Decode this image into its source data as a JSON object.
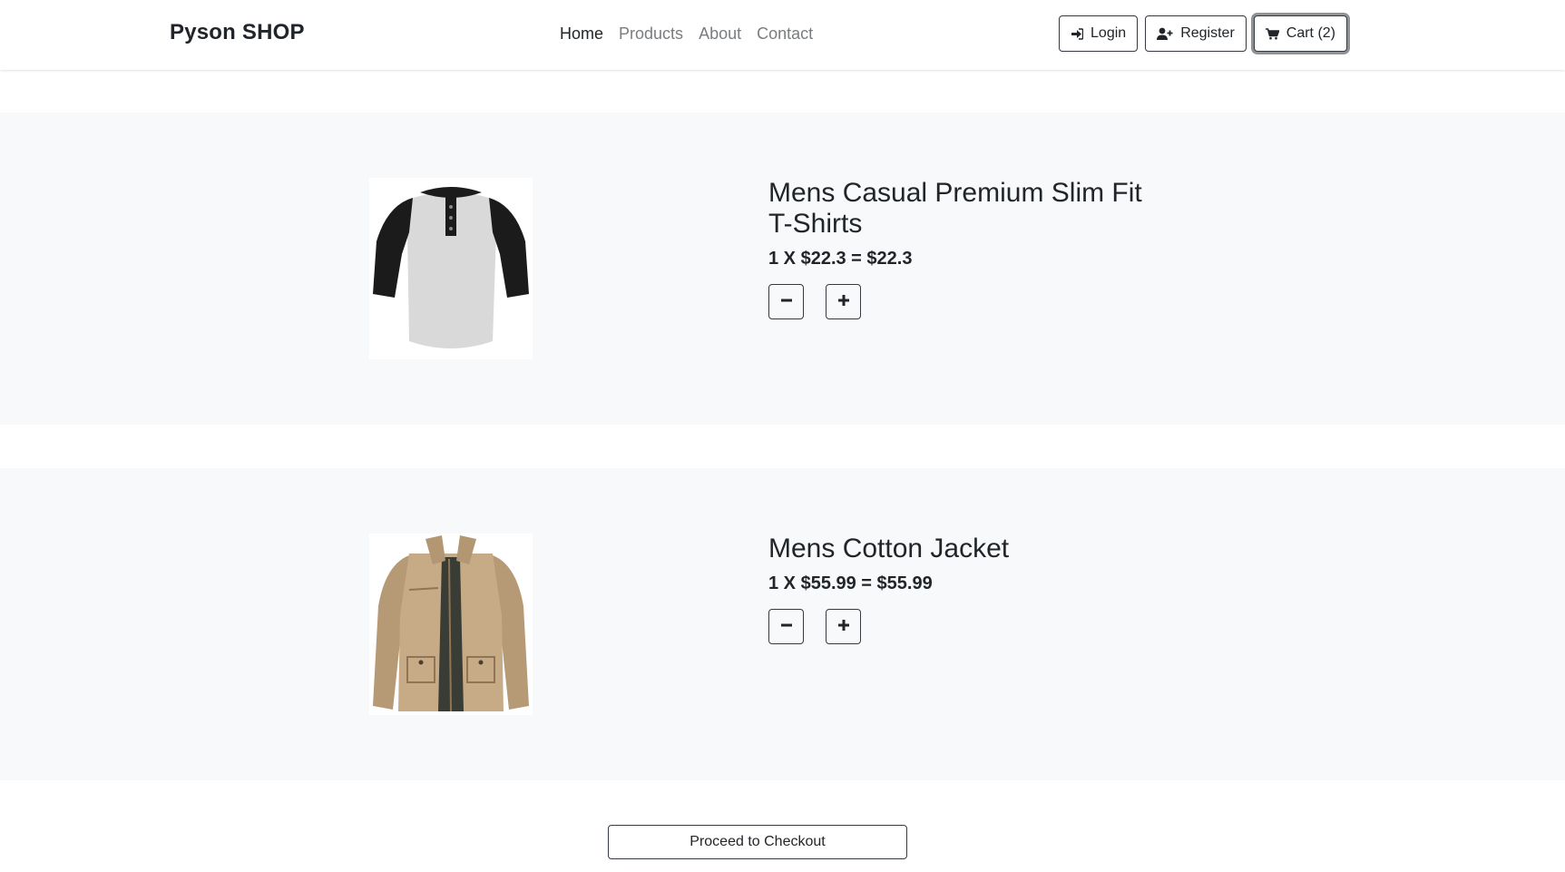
{
  "navbar": {
    "brand": "Pyson SHOP",
    "links": [
      {
        "label": "Home",
        "active": true
      },
      {
        "label": "Products",
        "active": false
      },
      {
        "label": "About",
        "active": false
      },
      {
        "label": "Contact",
        "active": false
      }
    ],
    "buttons": {
      "login": {
        "label": "Login",
        "icon": "sign-in-icon"
      },
      "register": {
        "label": "Register",
        "icon": "user-plus-icon"
      },
      "cart": {
        "label": "Cart (2)",
        "icon": "cart-icon"
      }
    }
  },
  "cart": {
    "items": [
      {
        "title": "Mens Casual Premium Slim Fit T-Shirts",
        "price_line": "1 X $22.3 = $22.3",
        "image": "raglan-henley-tshirt-grey-black"
      },
      {
        "title": "Mens Cotton Jacket",
        "price_line": "1 X $55.99 = $55.99",
        "image": "khaki-cotton-jacket"
      }
    ],
    "checkout_label": "Proceed to Checkout"
  },
  "colors": {
    "row_background": "#f8f9fa",
    "border_dark": "#343a40",
    "text": "#212529",
    "muted_link": "#7a7d80"
  }
}
